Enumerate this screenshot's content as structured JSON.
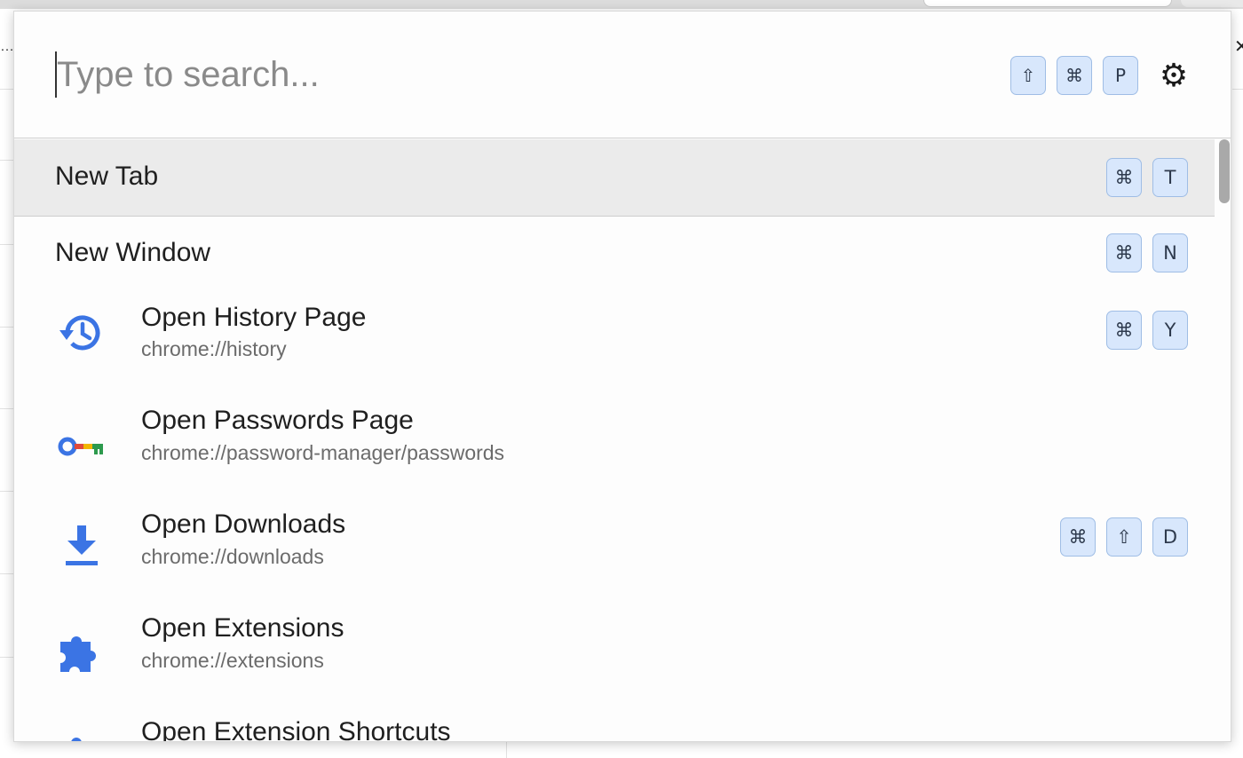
{
  "background": {
    "left_text": "…",
    "right_text": "✕"
  },
  "search": {
    "placeholder": "Type to search...",
    "value": ""
  },
  "hotkeys": [
    "⇧",
    "⌘",
    "P"
  ],
  "settings_icon": "gear-icon",
  "results": [
    {
      "title": "New Tab",
      "keys": [
        "⌘",
        "T"
      ],
      "selected": true
    },
    {
      "title": "New Window",
      "keys": [
        "⌘",
        "N"
      ]
    },
    {
      "title": "Open History Page",
      "subtitle": "chrome://history",
      "icon": "history-icon",
      "keys": [
        "⌘",
        "Y"
      ]
    },
    {
      "title": "Open Passwords Page",
      "subtitle": "chrome://password-manager/passwords",
      "icon": "key-icon",
      "keys": []
    },
    {
      "title": "Open Downloads",
      "subtitle": "chrome://downloads",
      "icon": "download-icon",
      "keys": [
        "⌘",
        "⇧",
        "D"
      ]
    },
    {
      "title": "Open Extensions",
      "subtitle": "chrome://extensions",
      "icon": "puzzle-icon",
      "keys": []
    },
    {
      "title": "Open Extension Shortcuts",
      "subtitle": "",
      "icon": "puzzle-icon",
      "keys": []
    }
  ],
  "colors": {
    "accent_blue": "#3b74e4",
    "key_bg": "#d8e7fc",
    "selected_row_bg": "#ebebeb"
  }
}
